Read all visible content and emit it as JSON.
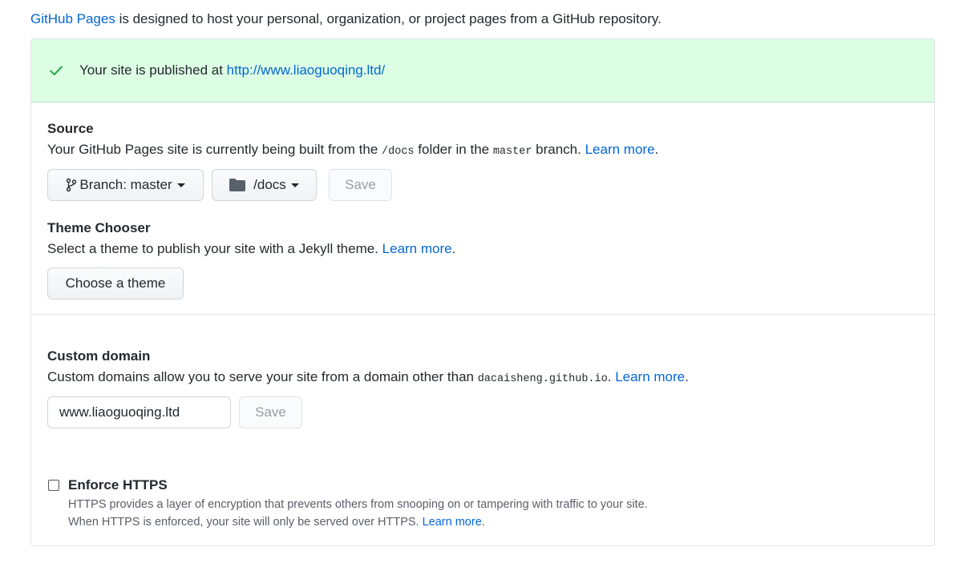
{
  "intro": {
    "link": "GitHub Pages",
    "text": " is designed to host your personal, organization, or project pages from a GitHub repository."
  },
  "flash": {
    "icon": "check-icon",
    "text": "Your site is published at ",
    "url": "http://www.liaoguoqing.ltd/"
  },
  "source": {
    "title": "Source",
    "desc_1": "Your GitHub Pages site is currently being built from the ",
    "folder": "/docs",
    "desc_2": " folder in the ",
    "branch": "master",
    "desc_3": " branch. ",
    "learn_more": "Learn more",
    "desc_end": ".",
    "branch_button": "Branch: master",
    "folder_button": "/docs",
    "save": "Save"
  },
  "theme": {
    "title": "Theme Chooser",
    "desc": "Select a theme to publish your site with a Jekyll theme. ",
    "learn_more": "Learn more",
    "desc_end": ".",
    "button": "Choose a theme"
  },
  "custom_domain": {
    "title": "Custom domain",
    "desc": "Custom domains allow you to serve your site from a domain other than ",
    "domain": "dacaisheng.github.io",
    "desc_2": ". ",
    "learn_more": "Learn more",
    "desc_end": ".",
    "input_value": "www.liaoguoqing.ltd",
    "save": "Save"
  },
  "https": {
    "label": "Enforce HTTPS",
    "checked": false,
    "note_1": "HTTPS provides a layer of encryption that prevents others from snooping on or tampering with traffic to your site.",
    "note_2": "When HTTPS is enforced, your site will only be served over HTTPS. ",
    "learn_more": "Learn more",
    "note_end": "."
  },
  "colors": {
    "link": "#0366d6",
    "flash_bg": "#dcffe4",
    "check": "#28a745"
  }
}
